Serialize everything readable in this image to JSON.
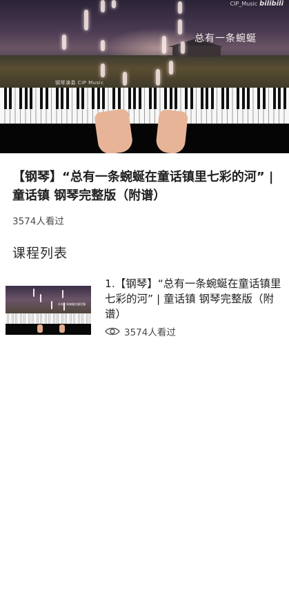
{
  "player": {
    "overlay_title": "总有一条蜿蜒",
    "watermark_text": "CIP_Music",
    "watermark_brand": "bilibili",
    "caption": "钢琴演奏 CIP Music"
  },
  "course": {
    "title": "【钢琴】“总有一条蜿蜒在童话镇里七彩的河” | 童话镇 钢琴完整版（附谱）",
    "views": "3574人看过"
  },
  "section": {
    "title": "课程列表"
  },
  "lessons": [
    {
      "title": "1.【钢琴】“总有一条蜿蜒在童话镇里七彩的河” | 童话镇 钢琴完整版（附谱）",
      "views": "3574人看过",
      "icon": "eye-icon",
      "thumbnail_caption": "总有一条蜿蜒在童话镇"
    }
  ],
  "colors": {
    "text_primary": "#1f1f1f",
    "text_secondary": "#4a4a4a",
    "background": "#ffffff"
  }
}
